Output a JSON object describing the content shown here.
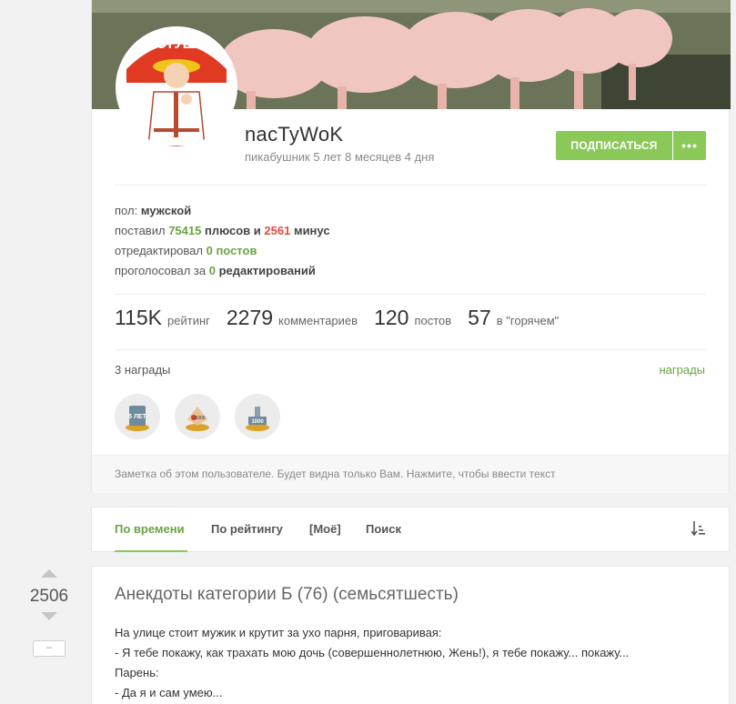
{
  "profile": {
    "logo_text": "НАСТУШО",
    "nickname": "nacTyWoK",
    "age": "пикабушник 5 лет 8 месяцев 4 дня",
    "subscribe_label": "ПОДПИСАТЬСЯ",
    "more_label": "•••",
    "info": {
      "gender_label": "пол:",
      "gender_value": "мужской",
      "put_label": "поставил",
      "pluses": "75415",
      "pluses_label": "плюсов и",
      "minuses": "2561",
      "minuses_label": "минус",
      "edited_label": "отредактировал",
      "edited_value": "0 постов",
      "voted_label": "проголосовал за",
      "voted_value": "0",
      "voted_suffix": "редактирований"
    },
    "stats": [
      {
        "num": "115K",
        "label": "рейтинг"
      },
      {
        "num": "2279",
        "label": "комментариев"
      },
      {
        "num": "120",
        "label": "постов"
      },
      {
        "num": "57",
        "label": "в \"горячем\""
      }
    ],
    "awards_count": "3 награды",
    "awards_link": "награды",
    "badges": [
      {
        "icon": "5-years-award-icon",
        "text": "5 ЛЕТ"
      },
      {
        "icon": "bag-award-icon",
        "text": "1000"
      },
      {
        "icon": "1000-award-icon",
        "text": "1000"
      }
    ],
    "note": "Заметка об этом пользователе. Будет видна только Вам. Нажмите, чтобы ввести текст"
  },
  "tabs": {
    "items": [
      "По времени",
      "По рейтингу",
      "[Моё]",
      "Поиск"
    ],
    "active": "По времени"
  },
  "post": {
    "rating": "2506",
    "collapse_label": "–",
    "title": "Анекдоты категории Б (76) (семьсятшесть)",
    "lines": [
      "На улице стоит мужик и крутит за ухо парня, приговаривая:",
      "- Я тебе покажу, как трахать мою дочь (совершеннолетнюю, Жень!), я тебе покажу... покажу...",
      "Парень:",
      "- Да я и сам умею..."
    ]
  },
  "colors": {
    "accent_green": "#8ac858",
    "link_green": "#6aa342",
    "minus_red": "#e24c3f"
  }
}
